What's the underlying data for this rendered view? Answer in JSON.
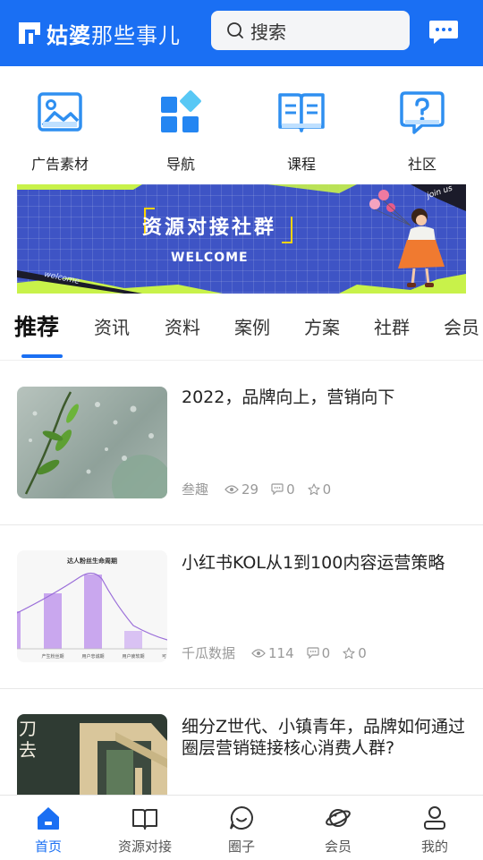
{
  "header": {
    "logo_bold": "姑婆",
    "logo_thin": "那些事儿",
    "search_placeholder": "搜索",
    "brand_color": "#1a6ff3",
    "chat_icon": "chat-bubble-icon"
  },
  "quick_links": [
    {
      "label": "广告素材",
      "icon": "image-icon"
    },
    {
      "label": "导航",
      "icon": "grid-nav-icon"
    },
    {
      "label": "课程",
      "icon": "book-icon"
    },
    {
      "label": "社区",
      "icon": "question-bubble-icon"
    }
  ],
  "banner": {
    "title": "资源对接社群",
    "subtitle": "WELCOME",
    "corner_text": "join us",
    "watermark": "welcome"
  },
  "tabs": [
    "推荐",
    "资讯",
    "资料",
    "案例",
    "方案",
    "社群",
    "会员"
  ],
  "active_tab": "推荐",
  "articles": [
    {
      "title": "2022，品牌向上，营销向下",
      "source": "叁趣",
      "views": "29",
      "comments": "0",
      "stars": "0"
    },
    {
      "title": "小红书KOL从1到100内容运营策略",
      "source": "千瓜数据",
      "views": "114",
      "comments": "0",
      "stars": "0",
      "thumb_chart": {
        "title": "达人粉丝生命周期",
        "labels": [
          "产生粉丝期",
          "用户忠诚期",
          "用户疲软期"
        ],
        "edge_label": "可"
      }
    },
    {
      "title": "细分Z世代、小镇青年，品牌如何通过圈层营销链接核心消费人群?",
      "thumb_text": "刀\n去"
    }
  ],
  "bottom_nav": [
    {
      "label": "首页",
      "icon": "home-icon",
      "active": true
    },
    {
      "label": "资源对接",
      "icon": "open-book-icon",
      "active": false
    },
    {
      "label": "圈子",
      "icon": "smile-bubble-icon",
      "active": false
    },
    {
      "label": "会员",
      "icon": "planet-icon",
      "active": false
    },
    {
      "label": "我的",
      "icon": "user-icon",
      "active": false
    }
  ]
}
